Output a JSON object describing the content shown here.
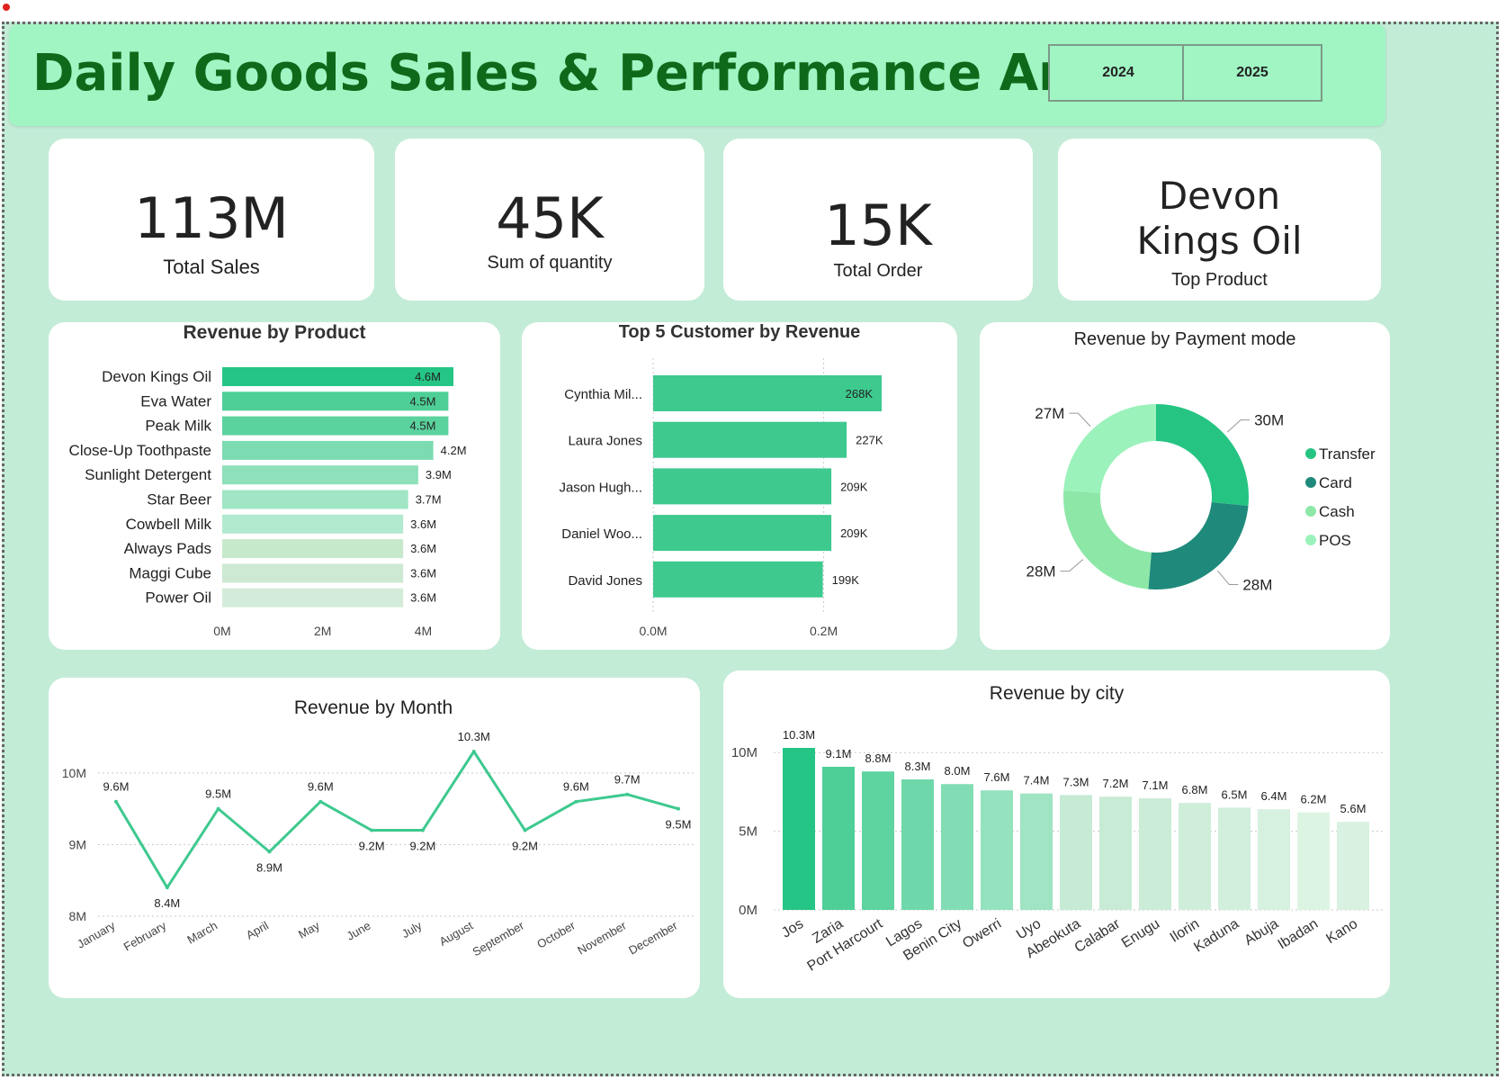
{
  "header": {
    "title": "Daily Goods Sales & Performance Analysis",
    "year_buttons": [
      "2024",
      "2025"
    ]
  },
  "kpis": [
    {
      "value": "113M",
      "label": "Total Sales"
    },
    {
      "value": "45K",
      "label": "Sum of quantity"
    },
    {
      "value": "15K",
      "label": "Total Order"
    },
    {
      "value_line1": "Devon",
      "value_line2": "Kings Oil",
      "label": "Top Product"
    }
  ],
  "chart_data": [
    {
      "type": "bar",
      "orientation": "horizontal",
      "title": "Revenue by Product",
      "categories": [
        "Devon Kings Oil",
        "Eva Water",
        "Peak Milk",
        "Close-Up Toothpaste",
        "Sunlight Detergent",
        "Star Beer",
        "Cowbell Milk",
        "Always Pads",
        "Maggi Cube",
        "Power Oil"
      ],
      "values": [
        4.6,
        4.5,
        4.5,
        4.2,
        3.9,
        3.7,
        3.6,
        3.6,
        3.6,
        3.6
      ],
      "data_labels": [
        "4.6M",
        "4.5M",
        "4.5M",
        "4.2M",
        "3.9M",
        "3.7M",
        "3.6M",
        "3.6M",
        "3.6M",
        "3.6M"
      ],
      "colors": [
        "#25c585",
        "#4ecf98",
        "#5bd39f",
        "#7cdbb1",
        "#8de0b9",
        "#a0e5c4",
        "#b2eacf",
        "#c6e9cc",
        "#cde9d3",
        "#d3ecd9"
      ],
      "xlim": [
        0,
        4.6
      ],
      "xticks": [
        "0M",
        "2M",
        "4M"
      ],
      "xtick_values": [
        0,
        2,
        4
      ]
    },
    {
      "type": "bar",
      "orientation": "horizontal",
      "title": "Top 5 Customer by Revenue",
      "categories": [
        "Cynthia Mil...",
        "Laura Jones",
        "Jason Hugh...",
        "Daniel Woo...",
        "David Jones"
      ],
      "values": [
        268,
        227,
        209,
        209,
        199
      ],
      "data_labels": [
        "268K",
        "227K",
        "209K",
        "209K",
        "199K"
      ],
      "color": "#3ec98f",
      "xlim": [
        0,
        268
      ],
      "xticks": [
        "0.0M",
        "0.2M"
      ],
      "xtick_values": [
        0,
        200
      ]
    },
    {
      "type": "pie",
      "style": "donut",
      "title": "Revenue by Payment mode",
      "labels": [
        "Transfer",
        "Card",
        "Cash",
        "POS"
      ],
      "values": [
        30,
        28,
        28,
        27
      ],
      "data_labels": [
        "30M",
        "28M",
        "28M",
        "27M"
      ],
      "colors": [
        "#26c483",
        "#1f8a7b",
        "#8de8a8",
        "#9bf2bb"
      ],
      "legend": "right"
    },
    {
      "type": "line",
      "title": "Revenue by Month",
      "categories": [
        "January",
        "February",
        "March",
        "April",
        "May",
        "June",
        "July",
        "August",
        "September",
        "October",
        "November",
        "December"
      ],
      "values": [
        9.6,
        8.4,
        9.5,
        8.9,
        9.6,
        9.2,
        9.2,
        10.3,
        9.2,
        9.6,
        9.7,
        9.5
      ],
      "data_labels": [
        "9.6M",
        "8.4M",
        "9.5M",
        "8.9M",
        "9.6M",
        "9.2M",
        "9.2M",
        "10.3M",
        "9.2M",
        "9.6M",
        "9.7M",
        "9.5M"
      ],
      "color": "#3ec98f",
      "ylim": [
        8,
        10.3
      ],
      "yticks": [
        "8M",
        "9M",
        "10M"
      ],
      "ytick_values": [
        8,
        9,
        10
      ],
      "grid": true
    },
    {
      "type": "bar",
      "orientation": "vertical",
      "title": "Revenue by city",
      "categories": [
        "Jos",
        "Zaria",
        "Port Harcourt",
        "Lagos",
        "Benin City",
        "Owerri",
        "Uyo",
        "Abeokuta",
        "Calabar",
        "Enugu",
        "Ilorin",
        "Kaduna",
        "Abuja",
        "Ibadan",
        "Kano"
      ],
      "values": [
        10.3,
        9.1,
        8.8,
        8.3,
        8.0,
        7.6,
        7.4,
        7.3,
        7.2,
        7.1,
        6.8,
        6.5,
        6.4,
        6.2,
        5.6
      ],
      "data_labels": [
        "10.3M",
        "9.1M",
        "8.8M",
        "8.3M",
        "8.0M",
        "7.6M",
        "7.4M",
        "7.3M",
        "7.2M",
        "7.1M",
        "6.8M",
        "6.5M",
        "6.4M",
        "6.2M",
        "5.6M"
      ],
      "colors": [
        "#25c585",
        "#4ecf98",
        "#5ed4a1",
        "#6fd8aa",
        "#82ddb4",
        "#95e2be",
        "#9fe4c3",
        "#c6ead4",
        "#c8ebd5",
        "#cbecd7",
        "#cfeeda",
        "#d2efdc",
        "#d6f1df",
        "#dcf5e3",
        "#d8f1e0"
      ],
      "ylim": [
        0,
        10.3
      ],
      "yticks": [
        "0M",
        "5M",
        "10M"
      ],
      "ytick_values": [
        0,
        5,
        10
      ],
      "grid": true
    }
  ]
}
